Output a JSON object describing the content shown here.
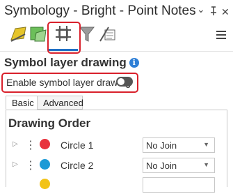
{
  "pane": {
    "title": "Symbology - Bright - Point Notes",
    "controls": {
      "menu": "⌄",
      "pin": "⊣",
      "close": "✕"
    }
  },
  "toolbar": {
    "tools": [
      {
        "icon": "primary-symbology-icon"
      },
      {
        "icon": "vary-symbology-icon"
      },
      {
        "icon": "symbol-layers-icon",
        "selected": true
      },
      {
        "icon": "filter-icon"
      },
      {
        "icon": "label-classes-icon"
      }
    ],
    "menu_icon": "hamburger-menu-icon"
  },
  "section": {
    "heading": "Symbol layer drawing",
    "info_glyph": "i",
    "toggle_label": "Enable symbol layer drawing",
    "toggle_on": false
  },
  "tabs": [
    {
      "label": "Basic",
      "active": true
    },
    {
      "label": "Advanced",
      "active": false
    }
  ],
  "drawing_order": {
    "heading": "Drawing Order",
    "rows": [
      {
        "name": "Circle 1",
        "color": "#e8333d",
        "join": "No Join"
      },
      {
        "name": "Circle 2",
        "color": "#1b9ad6",
        "join": "No Join"
      },
      {
        "name": "",
        "color": "#f2c318",
        "join": ""
      }
    ]
  },
  "colors": {
    "accent": "#1f6fc5",
    "highlight": "#d9202b"
  }
}
